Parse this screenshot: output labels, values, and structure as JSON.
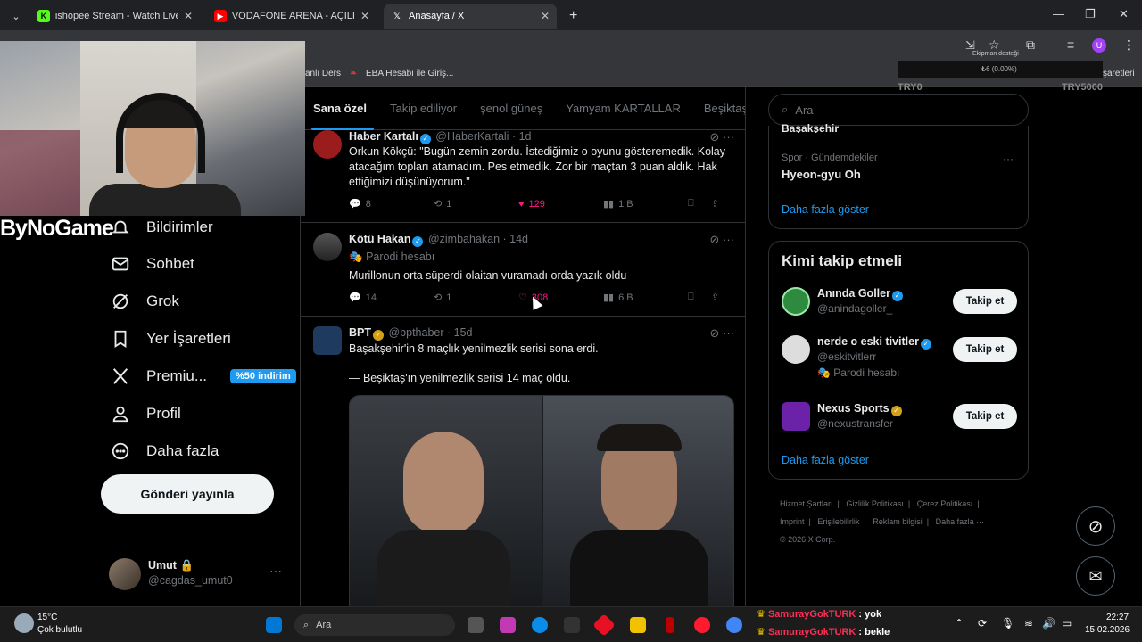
{
  "browser": {
    "tabs": [
      {
        "title": "ishopee Stream - Watch Live on",
        "active": false
      },
      {
        "title": "VODAFONE ARENA - AÇILIŞ MA",
        "active": false
      },
      {
        "title": "Anasayfa / X",
        "active": true
      }
    ],
    "bookmarks": [
      "anlı Ders",
      "EBA Hesabı ile Giriş..."
    ],
    "bookmarks_right": "şaretleri"
  },
  "overlay": {
    "donation_title": "Ekipman desteği",
    "donation_progress": "₺6 (0.00%)",
    "donation_progress_fraction": 0.0,
    "donation_min": "TRY0",
    "donation_max": "TRY5000",
    "streamer_logo": "ByNoGame",
    "chat": [
      {
        "user": "SamurayGokTURK",
        "msg": ": yok"
      },
      {
        "user": "SamurayGokTURK",
        "msg": ": bekle"
      }
    ]
  },
  "nav": {
    "items": [
      {
        "label": "Bildirimler",
        "icon": "bell-icon"
      },
      {
        "label": "Sohbet",
        "icon": "mail-icon"
      },
      {
        "label": "Grok",
        "icon": "grok-icon"
      },
      {
        "label": "Yer İşaretleri",
        "icon": "bookmark-icon"
      },
      {
        "label": "Premiu...",
        "icon": "x-logo-icon"
      },
      {
        "label": "Profil",
        "icon": "profile-icon"
      },
      {
        "label": "Daha fazla",
        "icon": "more-circle-icon"
      }
    ],
    "premium_badge": "%50 indirim",
    "post_button": "Gönderi yayınla",
    "user_name": "Umut",
    "user_handle": "@cagdas_umut0"
  },
  "feed_tabs": [
    "Sana özel",
    "Takip ediliyor",
    "şenol güneş",
    "Yamyam KARTALLAR",
    "Beşiktaş"
  ],
  "tweets": [
    {
      "name": "Haber Kartalı",
      "handle": "@HaberKartali",
      "time": "· 1d",
      "text": "Orkun Kökçü: \"Bugün zemin zordu. İstediğimiz o oyunu gösteremedik. Kolay atacağım topları atamadım. Pes etmedik. Zor bir maçtan 3 puan aldık. Hak ettiğimizi düşünüyorum.\"",
      "replies": "8",
      "reposts": "1",
      "likes": "129",
      "views": "1 B"
    },
    {
      "name": "Kötü Hakan",
      "handle": "@zimbahakan",
      "time": "· 14d",
      "parody": "Parodi hesabı",
      "text": "Murillonun orta süperdi olaitan vuramadı orda yazık oldu",
      "replies": "14",
      "reposts": "1",
      "likes": "308",
      "views": "6 B"
    },
    {
      "name": "BPT",
      "handle": "@bpthaber",
      "time": "· 15d",
      "text1": "Başakşehir'in 8 maçlık yenilmezlik serisi sona erdi.",
      "text2": "— Beşiktaş'ın yenilmezlik serisi 14 maç oldu."
    }
  ],
  "right": {
    "search_placeholder": "Ara",
    "trend_cut": "Başakşehir",
    "trend_category": "Spor · Gündemdekiler",
    "trend_name": "Hyeon-gyu Oh",
    "show_more": "Daha fazla göster",
    "who_to_follow_title": "Kimi takip etmeli",
    "follow_button": "Takip et",
    "suggestions": [
      {
        "name": "Anında Goller",
        "handle": "@anindagoller_",
        "verified": "blue"
      },
      {
        "name": "nerde o eski tivitler",
        "handle": "@eskitvitlerr",
        "verified": "blue",
        "note": "Parodi hesabı"
      },
      {
        "name": "Nexus Sports",
        "handle": "@nexustransfer",
        "verified": "gold"
      }
    ],
    "footer": [
      "Hizmet Şartları",
      "Gizlilik Politikası",
      "Çerez Politikası",
      "Imprint",
      "Erişilebilirlik",
      "Reklam bilgisi",
      "Daha fazla ···",
      "© 2026 X Corp."
    ]
  },
  "taskbar": {
    "temp": "15°C",
    "weather": "Çok bulutlu",
    "search": "Ara",
    "time": "22:27",
    "date": "15.02.2026"
  }
}
